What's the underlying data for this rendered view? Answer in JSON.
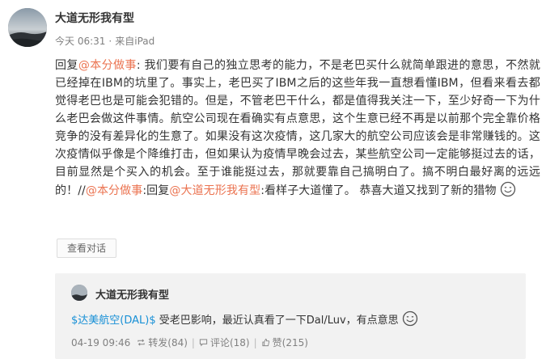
{
  "post": {
    "author": "大道无形我有型",
    "time": "今天 06:31",
    "separator": "·",
    "source": "来自iPad",
    "body": {
      "reply_prefix": "回复",
      "mention_1": "@本分做事",
      "segment_1": ": 我们要有自己的独立思考的能力，不是老巴买什么就简单跟进的意思，不然就已经掉在IBM的坑里了。事实上，老巴买了IBM之后的这些年我一直想看懂IBM，但看来看去都觉得老巴也是可能会犯错的。但是，不管老巴干什么，都是值得我关注一下，至少好奇一下为什么老巴会做这件事情。航空公司现在看确实有点意思，这个生意已经不再是以前那个完全靠价格竞争的没有差异化的生意了。如果没有这次疫情，这几家大的航空公司应该会是非常赚钱的。这次疫情似乎像是个降维打击，但如果认为疫情早晚会过去，某些航空公司一定能够挺过去的话，目前显然是个买入的机会。至于谁能挺过去，那就要靠自己搞明白了。搞不明白最好离的远远的！//",
      "mention_2": "@本分做事",
      "segment_2": ":回复",
      "mention_3": "@大道无形我有型",
      "segment_3": ":看样子大道懂了。 恭喜大道又找到了新的猎物",
      "emoji": "smile-emoji"
    },
    "view_conversation_label": "查看对话"
  },
  "retweet": {
    "author": "大道无形我有型",
    "topic": "$达美航空(DAL)$",
    "text": " 受老巴影响，最近认真看了一下Dal/Luv，有点意思",
    "emoji": "smile-emoji",
    "time": "04-19 09:46",
    "repost_label": "转发(84)",
    "comment_label": "评论(18)",
    "like_label": "赞(215)",
    "divider": "|"
  },
  "colors": {
    "mention": "#eb7350",
    "topic": "#1890d6",
    "text": "#333333",
    "muted": "#808080",
    "retweet_bg": "#f2f2f2"
  },
  "icons": [
    "avatar-photo",
    "smile-emoji",
    "repost-icon",
    "comment-icon",
    "like-icon"
  ]
}
